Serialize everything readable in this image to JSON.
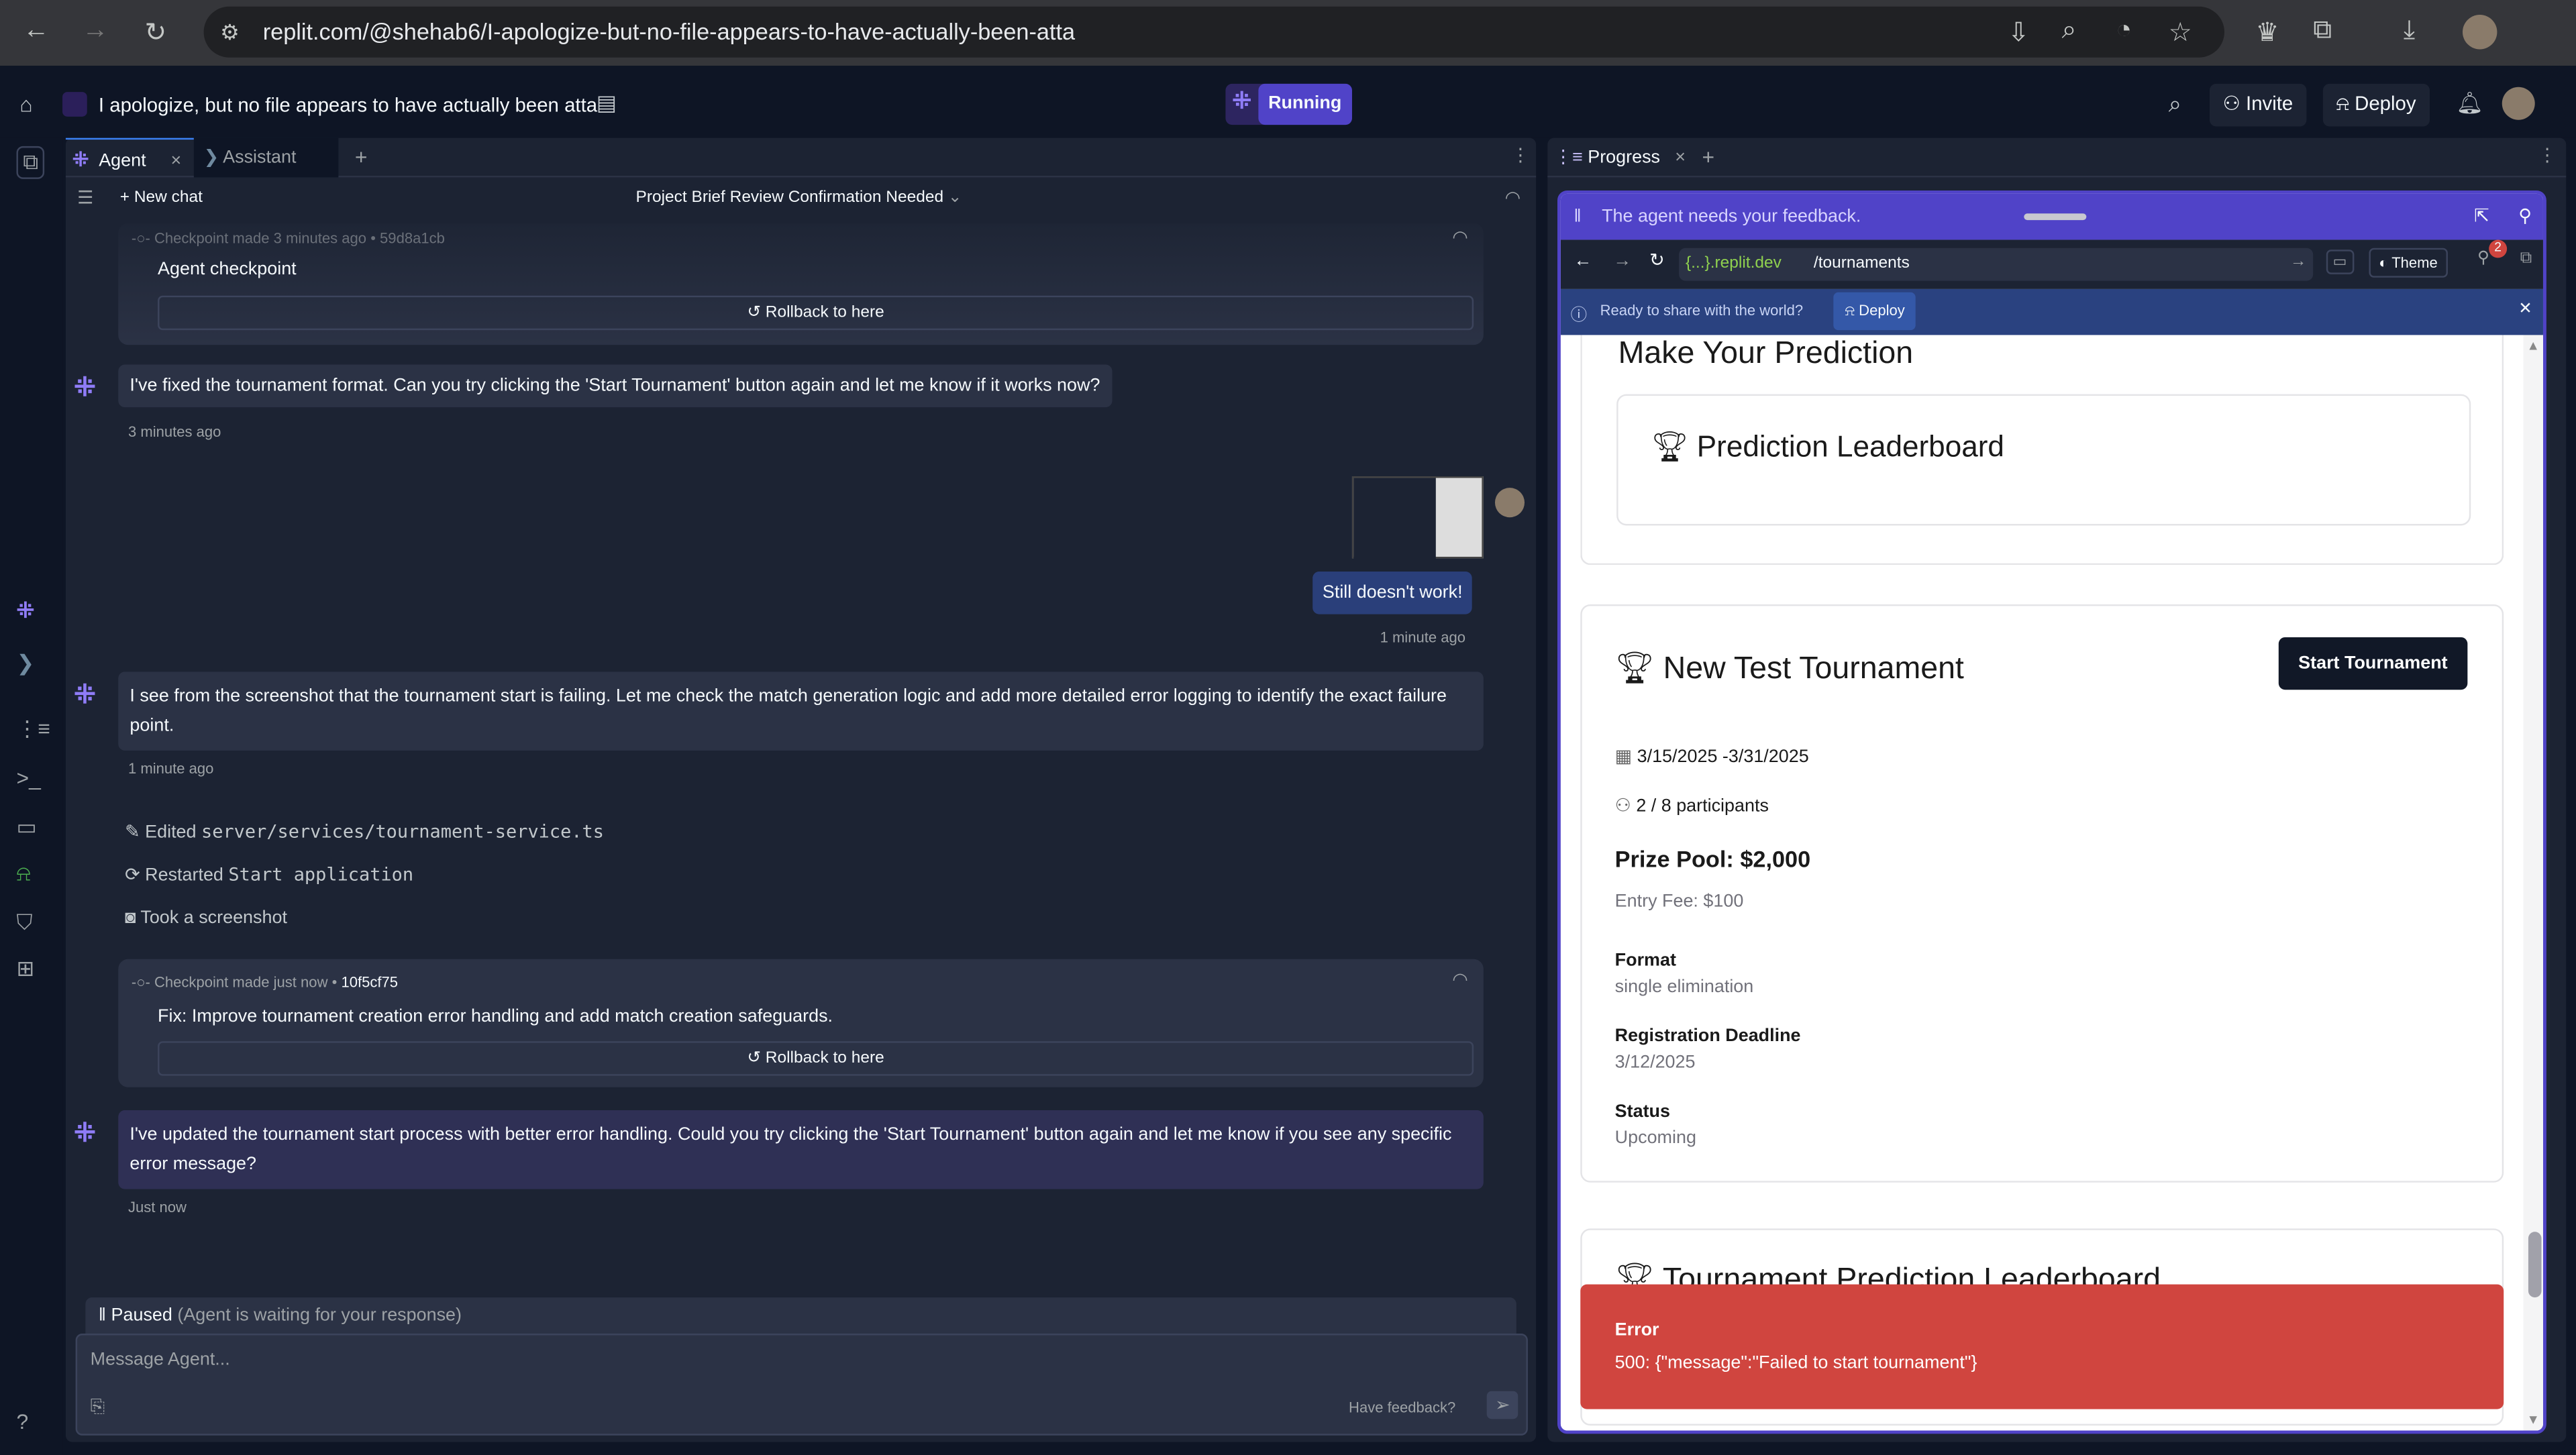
{
  "browser": {
    "url": "replit.com/@shehab6/I-apologize-but-no-file-appears-to-have-actually-been-atta"
  },
  "header": {
    "project_title": "I apologize, but no file appears to have actually been atta",
    "run_label": "Running",
    "invite": "Invite",
    "deploy": "Deploy"
  },
  "agent_panel": {
    "tabs": [
      {
        "label": "Agent"
      },
      {
        "label": "Assistant"
      }
    ],
    "new_chat": "New chat",
    "chat_title": "Project Brief Review Confirmation Needed",
    "messages": [
      {
        "type": "checkpoint",
        "prefix": "Checkpoint made",
        "time": "3 minutes ago",
        "hash": "59d8a1cb",
        "text": "Agent checkpoint",
        "rollback": "Rollback to here"
      },
      {
        "type": "agent",
        "text": "I've fixed the tournament format. Can you try clicking the 'Start Tournament' button again and let me know if it works now?",
        "time": "3 minutes ago"
      },
      {
        "type": "user",
        "text": "Still doesn't work!",
        "time": "1 minute ago"
      },
      {
        "type": "agent",
        "text": "I see from the screenshot that the tournament start is failing. Let me check the match generation logic and add more detailed error logging to identify the exact failure point.",
        "time": "1 minute ago"
      },
      {
        "type": "actions",
        "items": [
          {
            "verb": "Edited",
            "code": "server/services/tournament-service.ts"
          },
          {
            "verb": "Restarted",
            "code": "Start application"
          },
          {
            "verb": "Took a screenshot",
            "code": ""
          }
        ]
      },
      {
        "type": "checkpoint",
        "prefix": "Checkpoint made",
        "time": "just now",
        "hash": "10f5cf75",
        "text": "Fix: Improve tournament creation error handling and add match creation safeguards.",
        "rollback": "Rollback to here"
      },
      {
        "type": "agent",
        "text": "I've updated the tournament start process with better error handling. Could you try clicking the 'Start Tournament' button again and let me know if you see any specific error message?",
        "time": "Just now"
      }
    ],
    "paused": "Paused",
    "paused_note": "(Agent is waiting for your response)",
    "input_placeholder": "Message Agent...",
    "feedback": "Have feedback?"
  },
  "progress_panel": {
    "tab": "Progress",
    "feedback_banner": "The agent needs your feedback.",
    "domain": "{...}.replit.dev",
    "path": "/tournaments",
    "theme": "Theme",
    "badge_count": "2",
    "share_text": "Ready to share with the world?",
    "share_deploy": "Deploy",
    "app": {
      "prediction_title": "Make Your Prediction",
      "leaderboard_title": "Prediction Leaderboard",
      "tournament": {
        "name": "New Test Tournament",
        "start_button": "Start Tournament",
        "dates": "3/15/2025 -3/31/2025",
        "participants": "2 / 8 participants",
        "prize": "Prize Pool: $2,000",
        "entry_fee": "Entry Fee: $100",
        "format_label": "Format",
        "format": "single elimination",
        "deadline_label": "Registration Deadline",
        "deadline": "3/12/2025",
        "status_label": "Status",
        "status": "Upcoming"
      },
      "bottom_title": "Tournament Prediction Leaderboard",
      "error": {
        "title": "Error",
        "message": "500: {\"message\":\"Failed to start tournament\"}"
      }
    }
  },
  "colors": {
    "accent": "#5043c8",
    "error": "#d0453f",
    "bg": "#1c2333"
  }
}
